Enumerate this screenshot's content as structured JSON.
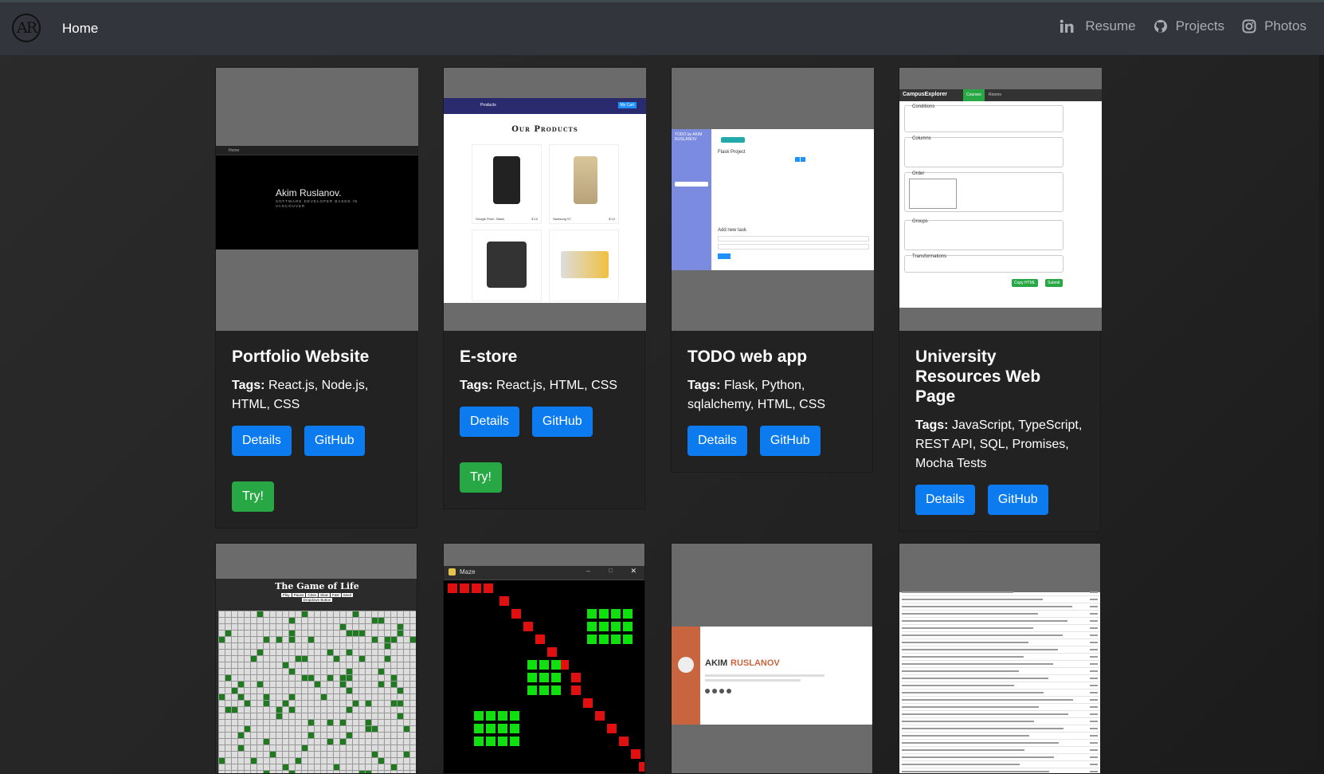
{
  "nav": {
    "logo": "AR",
    "home": "Home",
    "resume": "Resume",
    "projects": "Projects",
    "photos": "Photos",
    "icons": [
      "linkedin-icon",
      "github-icon",
      "instagram-icon"
    ]
  },
  "cards": [
    {
      "title": "Portfolio Website",
      "tags_label": "Tags:",
      "tags": "React.js, Node.js, HTML, CSS",
      "details": "Details",
      "github": "GitHub",
      "try": "Try!",
      "thumb": {
        "name": "Akim Ruslanov.",
        "subtitle": "SOFTWARE DEVELOPER BASED IN VANCOUVER",
        "nav_home": "Home"
      }
    },
    {
      "title": "E-store",
      "tags_label": "Tags:",
      "tags": "React.js, HTML, CSS",
      "details": "Details",
      "github": "GitHub",
      "try": "Try!",
      "thumb": {
        "header": "Products",
        "cart": "My Cart",
        "heading": "Our Products",
        "item1": "Google Pixel - Black",
        "price1": "$ 10",
        "item2": "Samsung S7",
        "price2": "$ 12"
      }
    },
    {
      "title": "TODO web app",
      "tags_label": "Tags:",
      "tags": "Flask, Python, sqlalchemy, HTML, CSS",
      "details": "Details",
      "github": "GitHub",
      "thumb": {
        "brand": "TODO by AKIM RUSLANOV",
        "project": "Flask Project",
        "add": "Add new task"
      }
    },
    {
      "title": "University Resources Web Page",
      "tags_label": "Tags:",
      "tags": "JavaScript, TypeScript, REST API, SQL, Promises, Mocha Tests",
      "details": "Details",
      "github": "GitHub",
      "thumb": {
        "brand": "CampusExplorer",
        "tab1": "Courses",
        "tab2": "Rooms",
        "conditions": "Conditions",
        "columns": "Columns",
        "order": "Order",
        "groups": "Groups",
        "transformations": "Transformations",
        "copy": "Copy HTML",
        "submit": "Submit"
      }
    },
    {
      "thumb": {
        "title": "The Game of Life",
        "buttons": [
          "Play",
          "Pause",
          "Clear",
          "Slow",
          "Fast",
          "Seed",
          "Dropdown Button"
        ]
      }
    },
    {
      "thumb": {
        "window_title": "Maze"
      }
    },
    {
      "thumb": {
        "name_first": "AKIM",
        "name_last": "RUSLANOV"
      }
    },
    {
      "thumb": {}
    }
  ],
  "colors": {
    "navbar": "#32353b",
    "card": "#222222",
    "blue": "#0d7bf0",
    "green": "#28a745",
    "thumb_bg": "#6b6b6b"
  }
}
